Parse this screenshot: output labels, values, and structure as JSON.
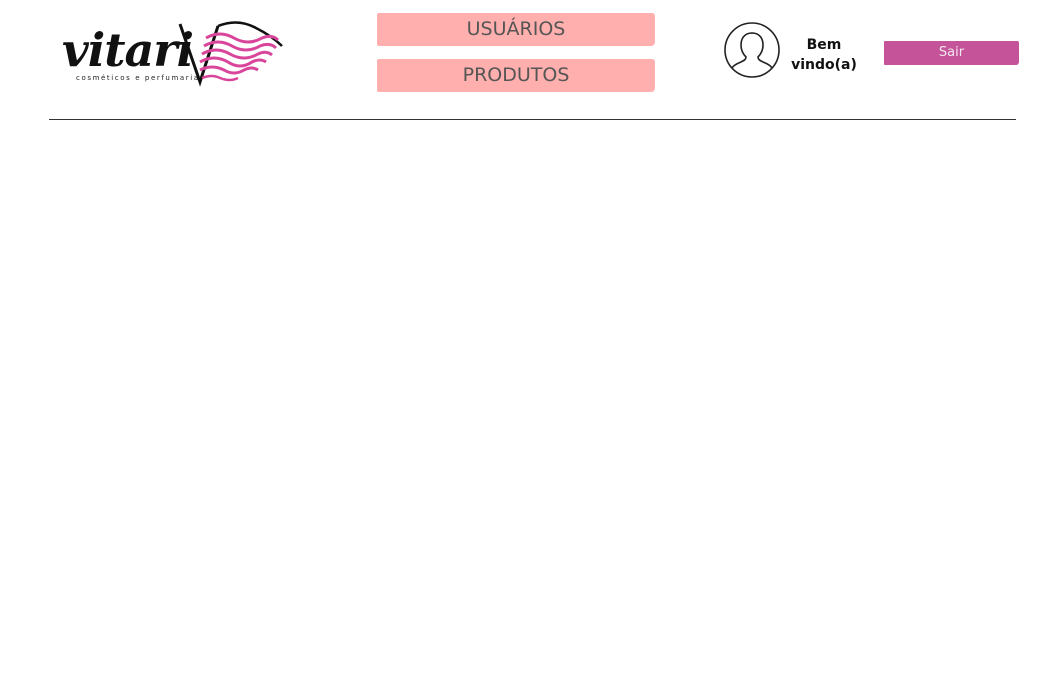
{
  "header": {
    "logo": {
      "wordmark": "vitari",
      "tagline": "cosméticos e perfumaria",
      "icon": "wave-v-logo-icon",
      "accent_color": "#d9459a"
    },
    "nav": [
      {
        "label": "USUÁRIOS"
      },
      {
        "label": "PRODUTOS"
      }
    ],
    "nav_color": "#ffb0ae",
    "user": {
      "avatar_icon": "user-avatar-icon",
      "welcome_text": "Bem vindo(a)"
    },
    "logout": {
      "label": "Sair",
      "color": "#c4539a"
    }
  }
}
